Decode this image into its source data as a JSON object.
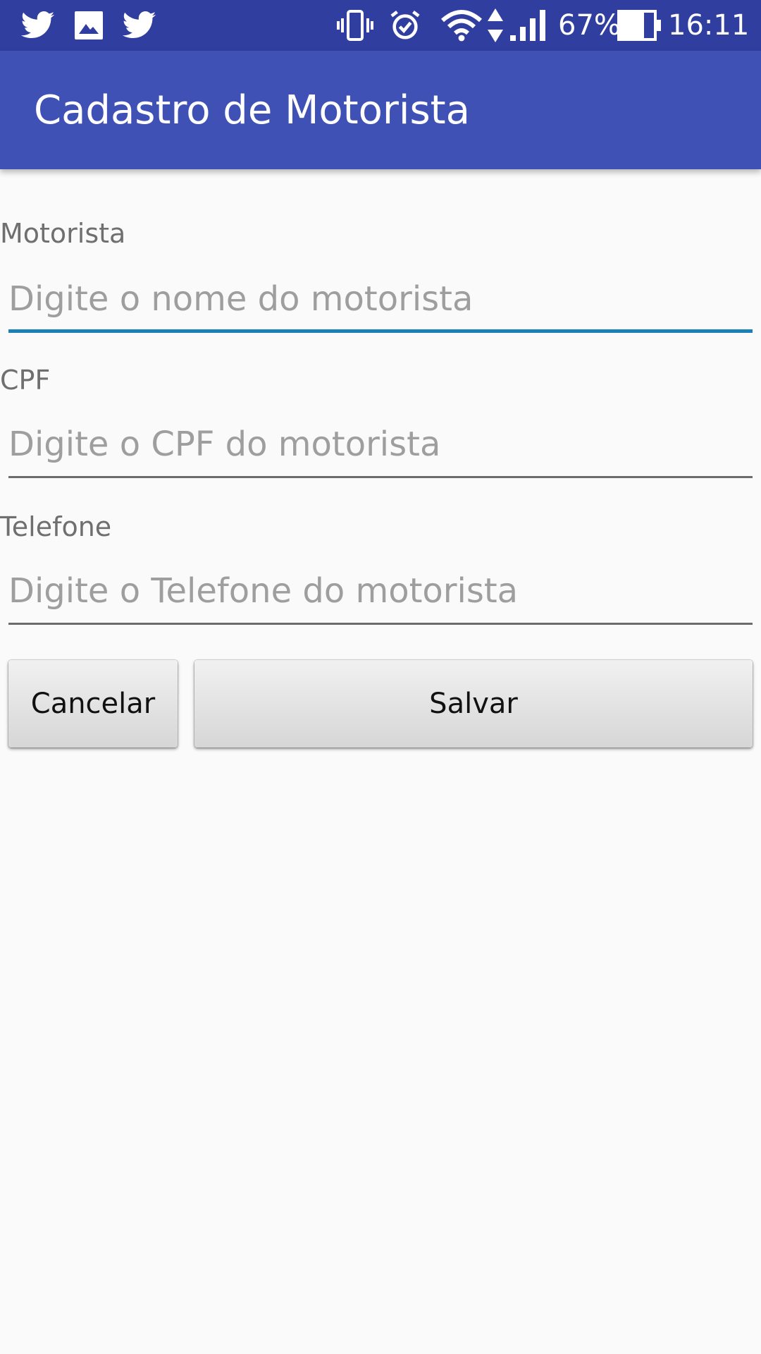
{
  "status_bar": {
    "left_icons": [
      "twitter-icon",
      "image-icon",
      "twitter-icon"
    ],
    "right_icons": [
      "vibrate-icon",
      "alarm-icon",
      "wifi-icon",
      "data-arrows-icon",
      "signal-icon",
      "battery-icon"
    ],
    "battery": "67%",
    "time": "16:11"
  },
  "app_bar": {
    "title": "Cadastro de Motorista",
    "color": "#3f51b5",
    "status_color": "#303f9f"
  },
  "form": {
    "fields": [
      {
        "label": "Motorista",
        "value": "",
        "placeholder": "Digite o nome do motorista",
        "focused": true
      },
      {
        "label": "CPF",
        "value": "",
        "placeholder": "Digite o CPF do motorista",
        "focused": false
      },
      {
        "label": "Telefone",
        "value": "",
        "placeholder": "Digite o Telefone do motorista",
        "focused": false
      }
    ],
    "focus_color": "#1a80b5"
  },
  "buttons": {
    "cancel_label": "Cancelar",
    "save_label": "Salvar"
  }
}
